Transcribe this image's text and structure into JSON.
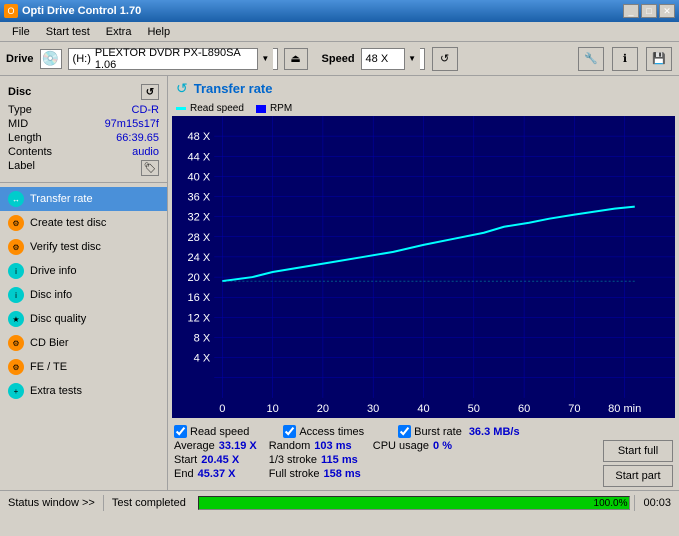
{
  "window": {
    "title": "Opti Drive Control 1.70"
  },
  "menu": {
    "items": [
      "File",
      "Start test",
      "Extra",
      "Help"
    ]
  },
  "toolbar": {
    "drive_label": "Drive",
    "drive_letter": "(H:)",
    "drive_name": "PLEXTOR DVDR  PX-L890SA 1.06",
    "speed_label": "Speed",
    "speed_value": "48 X"
  },
  "disc": {
    "header": "Disc",
    "type_label": "Type",
    "type_value": "CD-R",
    "mid_label": "MID",
    "mid_value": "97m15s17f",
    "length_label": "Length",
    "length_value": "66:39.65",
    "contents_label": "Contents",
    "contents_value": "audio",
    "label_label": "Label"
  },
  "nav": {
    "items": [
      {
        "id": "transfer-rate",
        "label": "Transfer rate",
        "active": true
      },
      {
        "id": "create-test-disc",
        "label": "Create test disc",
        "active": false
      },
      {
        "id": "verify-test-disc",
        "label": "Verify test disc",
        "active": false
      },
      {
        "id": "drive-info",
        "label": "Drive info",
        "active": false
      },
      {
        "id": "disc-info",
        "label": "Disc info",
        "active": false
      },
      {
        "id": "disc-quality",
        "label": "Disc quality",
        "active": false
      },
      {
        "id": "cd-bier",
        "label": "CD Bier",
        "active": false
      },
      {
        "id": "fe-te",
        "label": "FE / TE",
        "active": false
      },
      {
        "id": "extra-tests",
        "label": "Extra tests",
        "active": false
      }
    ]
  },
  "chart": {
    "title": "Transfer rate",
    "legend": {
      "read_speed_label": "Read speed",
      "rpm_label": "RPM"
    },
    "y_axis": [
      "48 X",
      "44 X",
      "40 X",
      "36 X",
      "32 X",
      "28 X",
      "24 X",
      "20 X",
      "16 X",
      "12 X",
      "8 X",
      "4 X"
    ],
    "x_axis": [
      "0",
      "10",
      "20",
      "30",
      "40",
      "50",
      "60",
      "70",
      "80 min"
    ]
  },
  "checkboxes": {
    "read_speed": "Read speed",
    "access_times": "Access times",
    "burst_rate_label": "Burst rate",
    "burst_rate_value": "36.3 MB/s"
  },
  "stats": {
    "average_label": "Average",
    "average_value": "33.19 X",
    "random_label": "Random",
    "random_value": "103 ms",
    "cpu_label": "CPU usage",
    "cpu_value": "0 %",
    "start_label": "Start",
    "start_value": "20.45 X",
    "stroke1_label": "1/3 stroke",
    "stroke1_value": "115 ms",
    "end_label": "End",
    "end_value": "45.37 X",
    "full_stroke_label": "Full stroke",
    "full_stroke_value": "158 ms",
    "btn_start_full": "Start full",
    "btn_start_part": "Start part"
  },
  "statusbar": {
    "status_window_label": "Status window >>",
    "test_completed_label": "Test completed",
    "progress_percent": "100.0%",
    "time": "00:03"
  }
}
